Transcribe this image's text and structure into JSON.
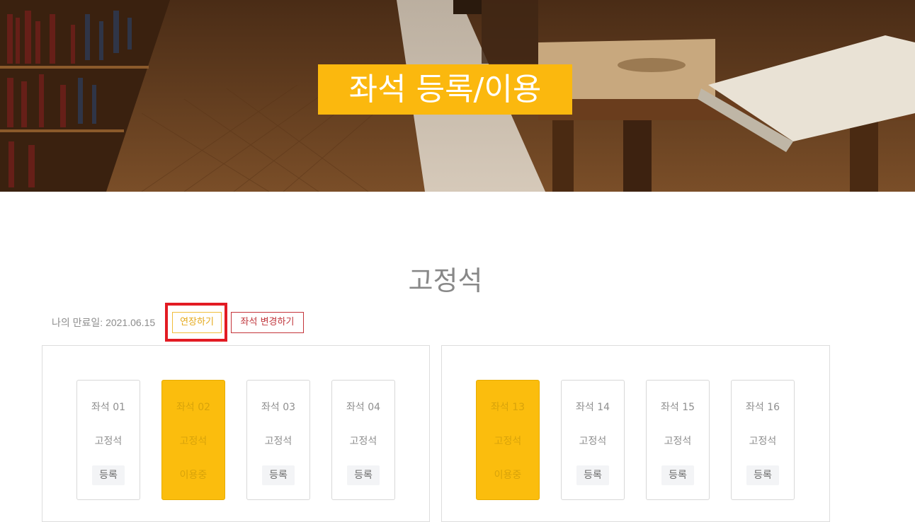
{
  "hero": {
    "title": "좌석 등록/이용"
  },
  "section": {
    "title": "고정석"
  },
  "expiry": {
    "label": "나의 만료일: 2021.06.15"
  },
  "actions": {
    "extend_label": "연장하기",
    "change_label": "좌석 변경하기"
  },
  "colors": {
    "accent": "#fbb80e",
    "highlight_outline": "#e21b23",
    "change_button": "#c0363c"
  },
  "seats_left": [
    {
      "name": "좌석 01",
      "type": "고정석",
      "status": "등록",
      "occupied": false
    },
    {
      "name": "좌석 02",
      "type": "고정석",
      "status": "이용중",
      "occupied": true
    },
    {
      "name": "좌석 03",
      "type": "고정석",
      "status": "등록",
      "occupied": false
    },
    {
      "name": "좌석 04",
      "type": "고정석",
      "status": "등록",
      "occupied": false
    }
  ],
  "seats_right": [
    {
      "name": "좌석 13",
      "type": "고정석",
      "status": "이용중",
      "occupied": true
    },
    {
      "name": "좌석 14",
      "type": "고정석",
      "status": "등록",
      "occupied": false
    },
    {
      "name": "좌석 15",
      "type": "고정석",
      "status": "등록",
      "occupied": false
    },
    {
      "name": "좌석 16",
      "type": "고정석",
      "status": "등록",
      "occupied": false
    }
  ]
}
